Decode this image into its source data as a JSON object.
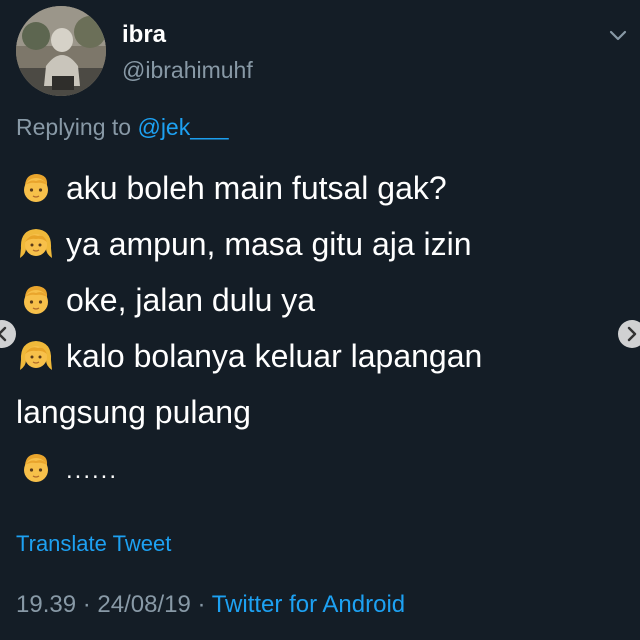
{
  "tweet": {
    "author": {
      "display_name": "ibra",
      "handle": "@ibrahimuhf"
    },
    "reply": {
      "prefix": "Replying to ",
      "mention": "@jek___"
    },
    "lines": [
      {
        "speaker": "boy-emoji",
        "text": "aku boleh main futsal gak?"
      },
      {
        "speaker": "girl-emoji",
        "text": "ya ampun, masa gitu aja izin"
      },
      {
        "speaker": "boy-emoji",
        "text": "oke, jalan dulu ya"
      },
      {
        "speaker": "girl-emoji",
        "text": "kalo bolanya keluar lapangan"
      },
      {
        "speaker": "",
        "text": "langsung pulang"
      },
      {
        "speaker": "boy-emoji",
        "text": "......"
      }
    ],
    "translate_label": "Translate Tweet",
    "time": "19.39",
    "separator": " · ",
    "date": "24/08/19",
    "separator2": " · ",
    "source": "Twitter for Android"
  },
  "colors": {
    "background": "#141d26",
    "text": "#ffffff",
    "secondary": "#8899a6",
    "link": "#1da1f2"
  }
}
